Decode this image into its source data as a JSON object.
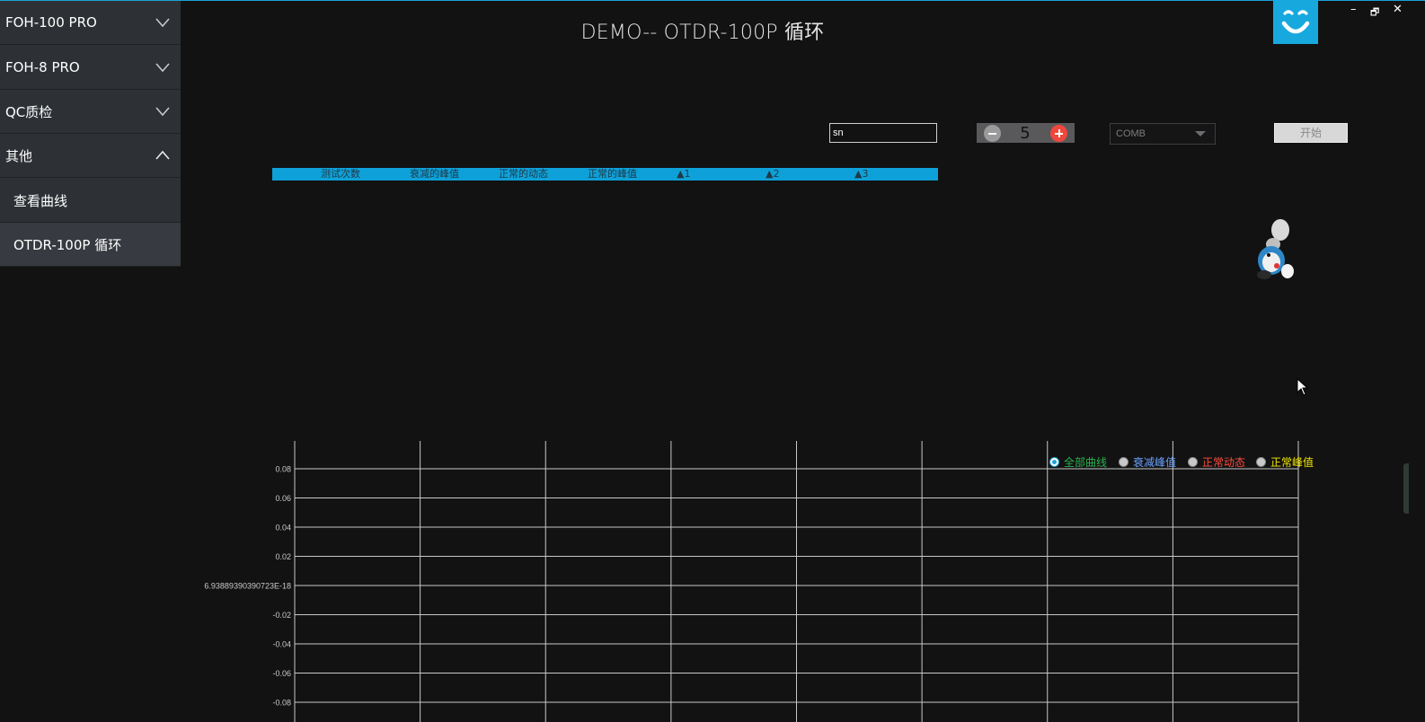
{
  "window": {
    "title": "DEMO-- OTDR-100P 循环",
    "minimize": "–",
    "restore": "🗗",
    "close": "✕"
  },
  "sidebar": {
    "items": [
      {
        "label": "FOH-100 PRO",
        "icon": "chevron-down-icon"
      },
      {
        "label": "FOH-8 PRO",
        "icon": "chevron-down-icon"
      },
      {
        "label": "QC质检",
        "icon": "chevron-down-icon"
      },
      {
        "label": "其他",
        "icon": "chevron-up-icon"
      }
    ],
    "subitems": [
      {
        "label": "查看曲线",
        "active": false
      },
      {
        "label": "OTDR-100P 循环",
        "active": true
      }
    ]
  },
  "controls": {
    "sn_value": "sn",
    "count": "5",
    "combo_selected": "COMB",
    "start_label": "开始"
  },
  "table": {
    "headers": [
      "测试次数",
      "衰减的峰值",
      "正常的动态",
      "正常的峰值",
      "▲1",
      "▲2",
      "▲3"
    ]
  },
  "chart_data": {
    "type": "line",
    "title": "",
    "xlabel": "",
    "ylabel": "",
    "y_ticks": [
      "0.08",
      "0.06",
      "0.04",
      "0.02",
      "6.93889390390723E-18",
      "-0.02",
      "-0.04",
      "-0.06",
      "-0.08"
    ],
    "y_values": [
      0.08,
      0.06,
      0.04,
      0.02,
      0.0,
      -0.02,
      -0.04,
      -0.06,
      -0.08
    ],
    "ylim": [
      -0.08,
      0.08
    ],
    "x_gridlines": 9,
    "grid": true,
    "series": [],
    "legend": [
      {
        "label": "全部曲线",
        "color": "#2bb24c",
        "checked": true
      },
      {
        "label": "衰减峰值",
        "color": "#6aa3ff",
        "checked": false
      },
      {
        "label": "正常动态",
        "color": "#ff4d3d",
        "checked": false
      },
      {
        "label": "正常峰值",
        "color": "#f2e600",
        "checked": false
      }
    ],
    "legend_position": "top-right"
  },
  "colors": {
    "accent": "#0ea1d9",
    "background": "#121213",
    "sidebar": "#2d3035"
  }
}
